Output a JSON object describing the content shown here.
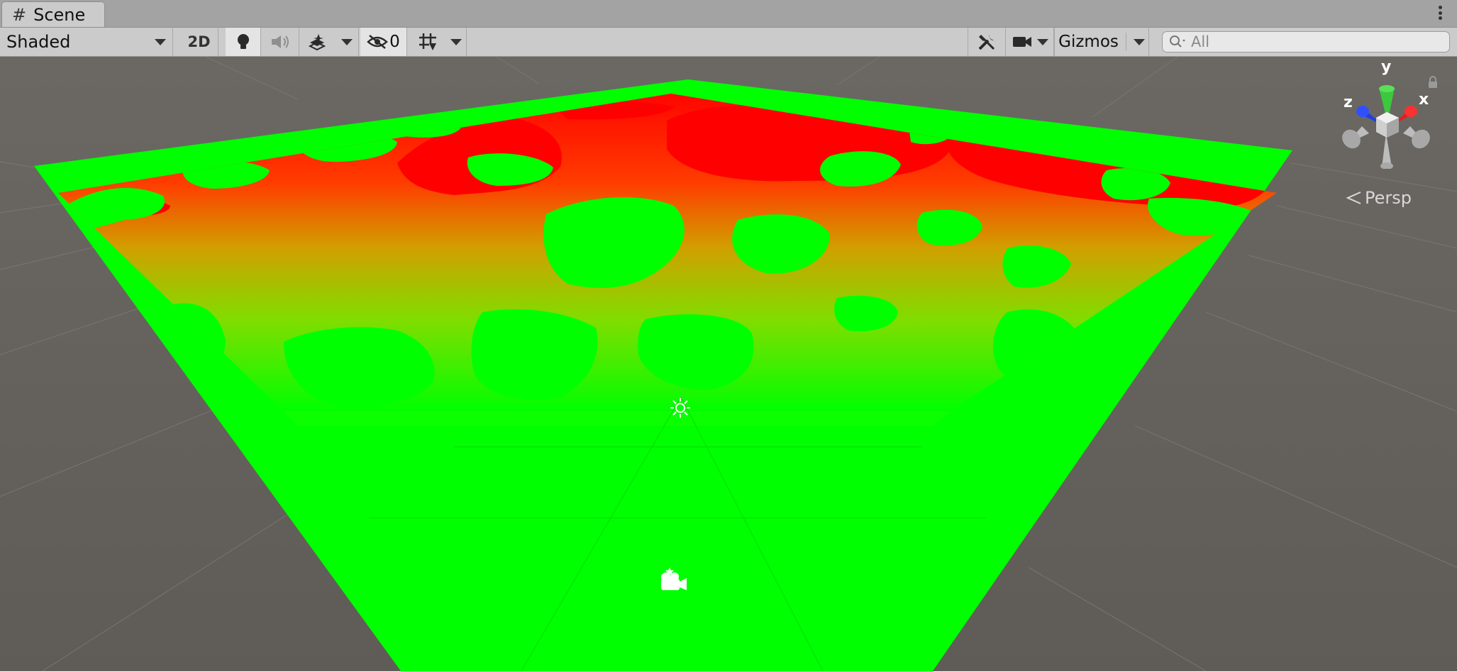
{
  "tab": {
    "title": "Scene",
    "icon": "hash-icon"
  },
  "toolbar": {
    "draw_mode": "Shaded",
    "mode_2d": "2D",
    "hidden_count": "0",
    "gizmos_label": "Gizmos",
    "search_placeholder": "All"
  },
  "gizmo": {
    "axis_x": "x",
    "axis_y": "y",
    "axis_z": "z",
    "projection": "Persp"
  },
  "colors": {
    "background": "#636058",
    "terrain_high": "#00ff00",
    "terrain_low": "#ff0000",
    "axis_x": "#e02020",
    "axis_y": "#40c040",
    "axis_z": "#2040e0"
  },
  "icons": [
    "hash-icon",
    "kebab-menu-icon",
    "light-bulb-icon",
    "audio-icon",
    "effects-layers-icon",
    "hidden-eye-icon",
    "grid-icon",
    "tools-icon",
    "camera-icon",
    "search-icon",
    "lock-icon",
    "sun-light-icon",
    "scene-camera-icon"
  ]
}
